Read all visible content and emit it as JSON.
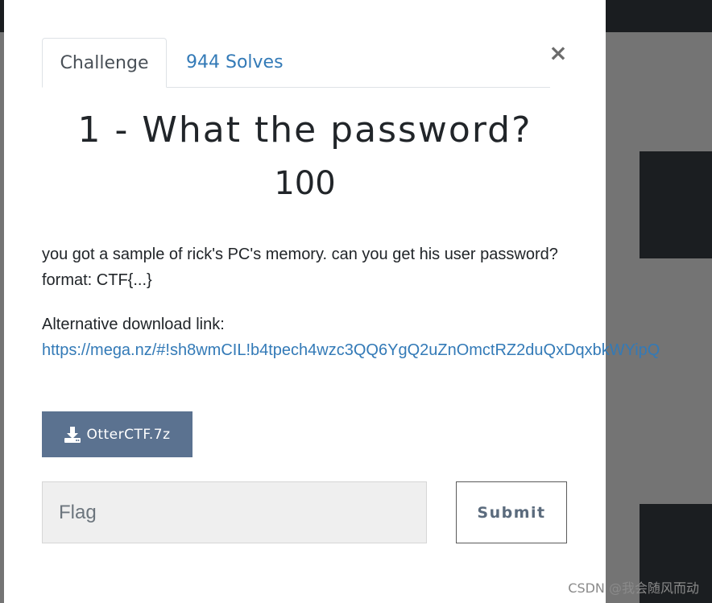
{
  "tabs": [
    {
      "label": "Challenge",
      "active": true
    },
    {
      "label": "944 Solves",
      "active": false
    }
  ],
  "close_label": "×",
  "challenge": {
    "title": "1 - What the password?",
    "points": "100",
    "description_lines": [
      "you got a sample of rick's PC's memory. can you get his user password?",
      "format: CTF{...}"
    ],
    "alt_download_label": "Alternative download link:",
    "alt_download_url": "https://mega.nz/#!sh8wmCIL!b4tpech4wzc3QQ6YgQ2uZnOmctRZ2duQxDqxbkWYipQ",
    "file_button_label": "OtterCTF.7z",
    "file_icon": "download-icon"
  },
  "flag_form": {
    "placeholder": "Flag",
    "value": "",
    "submit_label": "Submit"
  },
  "watermark": "CSDN @我会随风而动",
  "colors": {
    "link": "#337ab7",
    "file_button": "#5b7290",
    "input_bg": "#efefef",
    "backdrop": "#747474",
    "background_dark": "#1b1e21"
  }
}
